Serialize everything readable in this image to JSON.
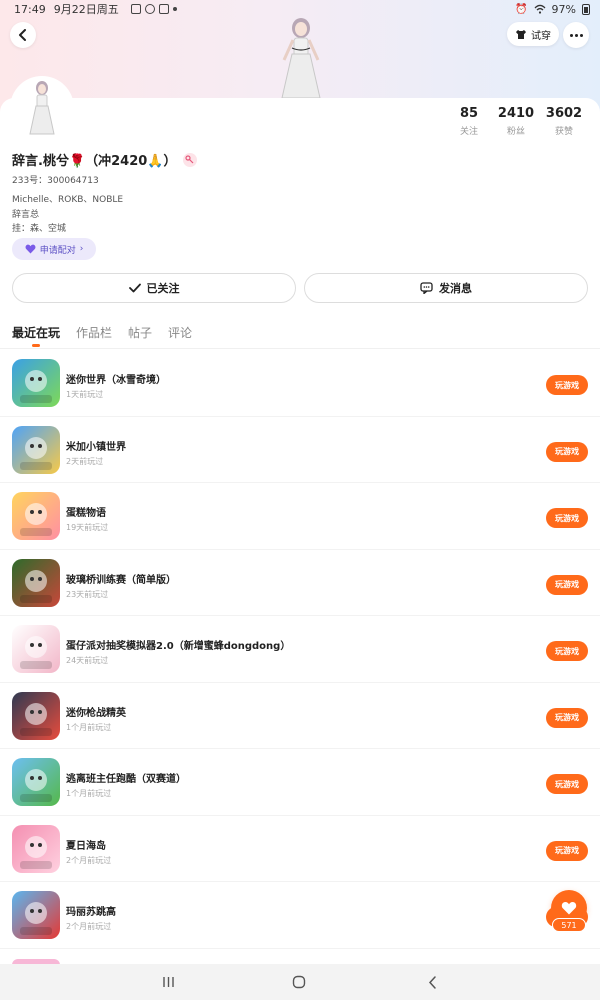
{
  "status_bar": {
    "time": "17:49",
    "date": "9月22日周五",
    "battery": "97%"
  },
  "header": {
    "tryon_label": "试穿"
  },
  "profile": {
    "name": "辞言.桃兮🌹（冲2420🙏）",
    "id_line": "233号：300064713",
    "line2": "Michelle、ROKB、NOBLE",
    "line3": "辞言总",
    "line4": "挂：森、空城",
    "pair_label": "申请配对",
    "stats": [
      {
        "num": "85",
        "label": "关注"
      },
      {
        "num": "2410",
        "label": "粉丝"
      },
      {
        "num": "3602",
        "label": "获赞"
      }
    ],
    "follow_label": "已关注",
    "message_label": "发消息"
  },
  "tabs": [
    "最近在玩",
    "作品栏",
    "帖子",
    "评论"
  ],
  "games": [
    {
      "title": "迷你世界（冰雪奇境）",
      "time": "1天前玩过",
      "color1": "#3aa0e6",
      "color2": "#7ed957"
    },
    {
      "title": "米加小镇世界",
      "time": "2天前玩过",
      "color1": "#4fa3f7",
      "color2": "#f7c948"
    },
    {
      "title": "蛋糕物语",
      "time": "19天前玩过",
      "color1": "#ffd45e",
      "color2": "#ff8fa3"
    },
    {
      "title": "玻璃桥训练赛（简单版）",
      "time": "23天前玩过",
      "color1": "#2d6b2b",
      "color2": "#c9473a"
    },
    {
      "title": "蛋仔派对抽奖模拟器2.0（新增蜜蜂dongdong）",
      "time": "24天前玩过",
      "color1": "#ffffff",
      "color2": "#f2b6c8"
    },
    {
      "title": "迷你枪战精英",
      "time": "1个月前玩过",
      "color1": "#2f3a52",
      "color2": "#e84c3d"
    },
    {
      "title": "逃离班主任跑酷（双赛道）",
      "time": "1个月前玩过",
      "color1": "#6dbff2",
      "color2": "#55b84a"
    },
    {
      "title": "夏日海岛",
      "time": "2个月前玩过",
      "color1": "#f48fb1",
      "color2": "#ffd1e0"
    },
    {
      "title": "玛丽苏跳高",
      "time": "2个月前玩过",
      "color1": "#5ab6f0",
      "color2": "#e53935"
    }
  ],
  "play_label": "玩游戏",
  "like_count": "571",
  "colors": {
    "accent": "#ff6a1a",
    "pair_bg": "#ece9fb",
    "pair_text": "#5b4fc4"
  }
}
